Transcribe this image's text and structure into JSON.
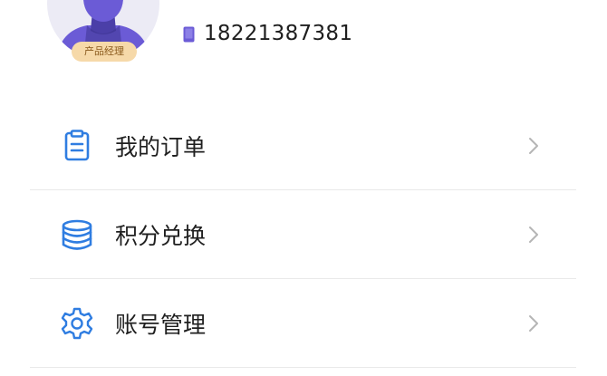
{
  "profile": {
    "role_badge": "产品经理",
    "phone": "18221387381",
    "avatar_icon": "person-avatar-icon",
    "phone_icon": "phone-icon"
  },
  "menu": {
    "items": [
      {
        "label": "我的订单",
        "icon": "clipboard-icon"
      },
      {
        "label": "积分兑换",
        "icon": "coins-stack-icon"
      },
      {
        "label": "账号管理",
        "icon": "gear-icon"
      }
    ]
  },
  "colors": {
    "accent": "#2f7de1",
    "avatar_figure": "#6b5bd6",
    "badge_bg": "#f6d9a9",
    "phone_icon": "#6b5bd6"
  }
}
